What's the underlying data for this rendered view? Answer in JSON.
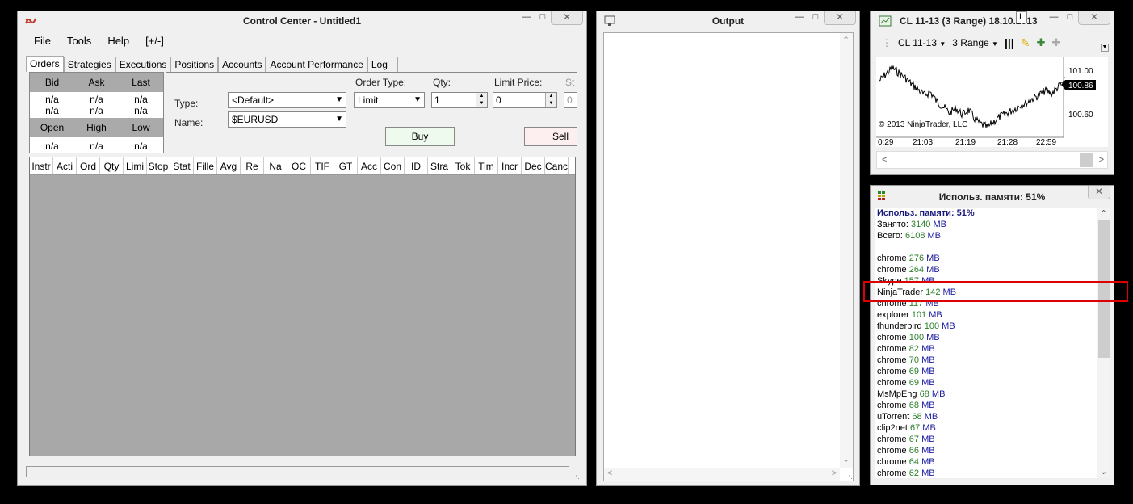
{
  "control_center": {
    "title": "Control Center - Untitled1",
    "menu": [
      "File",
      "Tools",
      "Help",
      "[+/-]"
    ],
    "tabs": [
      "Orders",
      "Strategies",
      "Executions",
      "Positions",
      "Accounts",
      "Account Performance",
      "Log"
    ],
    "quote": {
      "head1": [
        "Bid",
        "Ask",
        "Last"
      ],
      "row1": [
        "n/a",
        "n/a",
        "n/a"
      ],
      "row2": [
        "n/a",
        "n/a",
        "n/a"
      ],
      "head2": [
        "Open",
        "High",
        "Low"
      ],
      "row3": [
        "n/a",
        "n/a",
        "n/a"
      ]
    },
    "order": {
      "type_label": "Type:",
      "type_value": "<Default>",
      "name_label": "Name:",
      "name_value": "$EURUSD",
      "order_type_label": "Order Type:",
      "order_type_value": "Limit",
      "qty_label": "Qty:",
      "qty_value": "1",
      "limit_label": "Limit Price:",
      "limit_value": "0",
      "stop_label": "St",
      "stop_value": "0",
      "buy_label": "Buy",
      "sell_label": "Sell"
    },
    "columns": [
      "Instr",
      "Acti",
      "Ord",
      "Qty",
      "Limi",
      "Stop",
      "Stat",
      "Fille",
      "Avg",
      "Re",
      "Na",
      "OC",
      "TIF",
      "GT",
      "Acc",
      "Con",
      "ID",
      "Stra",
      "Tok",
      "Tim",
      "Incr",
      "Dec",
      "Canc"
    ]
  },
  "output": {
    "title": "Output"
  },
  "chart": {
    "title": "CL 11-13 (3 Range)  18.10.2013",
    "tooltip": "L",
    "instrument": "CL 11-13",
    "period": "3 Range",
    "copyright": "© 2013 NinjaTrader, LLC",
    "price_ticks": [
      "101.00",
      "100.60"
    ],
    "last_price": "100.86",
    "time_ticks": [
      "0:29",
      "21:03",
      "21:19",
      "21:28",
      "22:59"
    ]
  },
  "memory": {
    "title": "Использ. памяти: 51%",
    "summary": "Использ. памяти: 51%",
    "used_label": "Занято:",
    "used_value": "3140",
    "total_label": "Всего:",
    "total_value": "6108",
    "unit": "MB",
    "processes": [
      {
        "name": "chrome",
        "value": "276"
      },
      {
        "name": "chrome",
        "value": "264"
      },
      {
        "name": "Skype",
        "value": "157"
      },
      {
        "name": "NinjaTrader",
        "value": "142"
      },
      {
        "name": "chrome",
        "value": "117"
      },
      {
        "name": "explorer",
        "value": "101"
      },
      {
        "name": "thunderbird",
        "value": "100"
      },
      {
        "name": "chrome",
        "value": "100"
      },
      {
        "name": "chrome",
        "value": "82"
      },
      {
        "name": "chrome",
        "value": "70"
      },
      {
        "name": "chrome",
        "value": "69"
      },
      {
        "name": "chrome",
        "value": "69"
      },
      {
        "name": "MsMpEng",
        "value": "68"
      },
      {
        "name": "chrome",
        "value": "68"
      },
      {
        "name": "uTorrent",
        "value": "68"
      },
      {
        "name": "clip2net",
        "value": "67"
      },
      {
        "name": "chrome",
        "value": "67"
      },
      {
        "name": "chrome",
        "value": "66"
      },
      {
        "name": "chrome",
        "value": "64"
      },
      {
        "name": "chrome",
        "value": "62"
      }
    ]
  }
}
